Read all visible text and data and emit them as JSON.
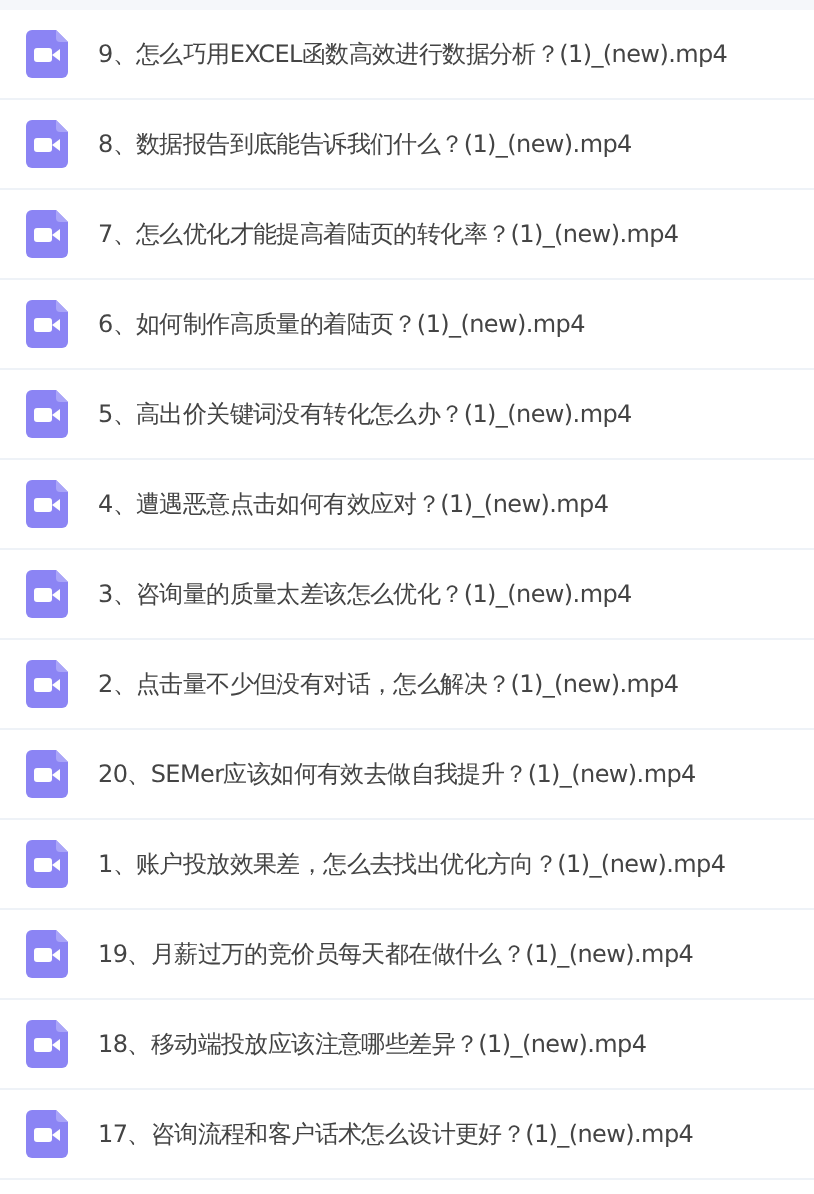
{
  "files": [
    {
      "name": "9、怎么巧用EXCEL函数高效进行数据分析？(1)_(new).mp4"
    },
    {
      "name": "8、数据报告到底能告诉我们什么？(1)_(new).mp4"
    },
    {
      "name": "7、怎么优化才能提高着陆页的转化率？(1)_(new).mp4"
    },
    {
      "name": "6、如何制作高质量的着陆页？(1)_(new).mp4"
    },
    {
      "name": "5、高出价关键词没有转化怎么办？(1)_(new).mp4"
    },
    {
      "name": "4、遭遇恶意点击如何有效应对？(1)_(new).mp4"
    },
    {
      "name": "3、咨询量的质量太差该怎么优化？(1)_(new).mp4"
    },
    {
      "name": "2、点击量不少但没有对话，怎么解决？(1)_(new).mp4"
    },
    {
      "name": "20、SEMer应该如何有效去做自我提升？(1)_(new).mp4"
    },
    {
      "name": "1、账户投放效果差，怎么去找出优化方向？(1)_(new).mp4"
    },
    {
      "name": "19、月薪过万的竞价员每天都在做什么？(1)_(new).mp4"
    },
    {
      "name": "18、移动端投放应该注意哪些差异？(1)_(new).mp4"
    },
    {
      "name": "17、咨询流程和客户话术怎么设计更好？(1)_(new).mp4"
    }
  ]
}
